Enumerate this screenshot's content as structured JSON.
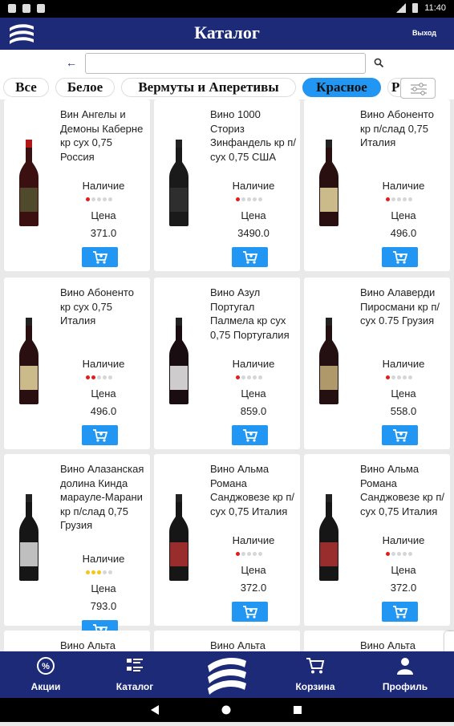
{
  "status": {
    "time": "11:40"
  },
  "app": {
    "title": "Каталог",
    "exit_label": "Выход"
  },
  "search": {
    "value": "",
    "placeholder": ""
  },
  "chips": [
    {
      "label": "Все"
    },
    {
      "label": "Белое"
    },
    {
      "label": "Вермуты и Аперетивы"
    },
    {
      "label": "Красное",
      "active": true
    },
    {
      "label": "Р"
    }
  ],
  "labels": {
    "stock": "Наличие",
    "price": "Цена"
  },
  "products": [
    {
      "name": "Вин Ангелы и Демоны Каберне кр сух 0,75 Россия",
      "price": "371.0",
      "stock_level": 1,
      "stock_color": "#e41c1c"
    },
    {
      "name": "Вино 1000 Сториз Зинфандель кр п/сух 0,75 США",
      "price": "3490.0",
      "stock_level": 1,
      "stock_color": "#e41c1c"
    },
    {
      "name": "Вино Абоненто кр п/слад 0,75 Италия",
      "price": "496.0",
      "stock_level": 1,
      "stock_color": "#e41c1c"
    },
    {
      "name": "Вино Абоненто кр сух 0,75 Италия",
      "price": "496.0",
      "stock_level": 2,
      "stock_color": "#e41c1c"
    },
    {
      "name": "Вино Азул Португал Палмела кр сух 0,75 Португалия",
      "price": "859.0",
      "stock_level": 1,
      "stock_color": "#e41c1c"
    },
    {
      "name": "Вино Алаверди Пиросмани кр п/сух 0.75 Грузия",
      "price": "558.0",
      "stock_level": 1,
      "stock_color": "#e41c1c"
    },
    {
      "name": "Вино Алазанская долина Кинда марауле-Марани кр п/слад 0,75 Грузия",
      "price": "793.0",
      "stock_level": 3,
      "stock_color": "#f5c518"
    },
    {
      "name": "Вино Альма Романа Санджовезе кр п/сух 0,75 Италия",
      "price": "372.0",
      "stock_level": 1,
      "stock_color": "#e41c1c"
    },
    {
      "name": "Вино Альма Романа Санджовезе кр п/сух 0,75 Италия",
      "price": "372.0",
      "stock_level": 1,
      "stock_color": "#e41c1c"
    },
    {
      "name": "Вино Альта",
      "price": "",
      "stock_level": 0
    },
    {
      "name": "Вино Альта",
      "price": "",
      "stock_level": 0
    },
    {
      "name": "Вино Альта",
      "price": "",
      "stock_level": 0
    }
  ],
  "nav": {
    "promos": "Акции",
    "catalog": "Каталог",
    "cart": "Корзина",
    "profile": "Профиль"
  },
  "colors": {
    "brand": "#1c2a78",
    "accent": "#2196f3"
  }
}
